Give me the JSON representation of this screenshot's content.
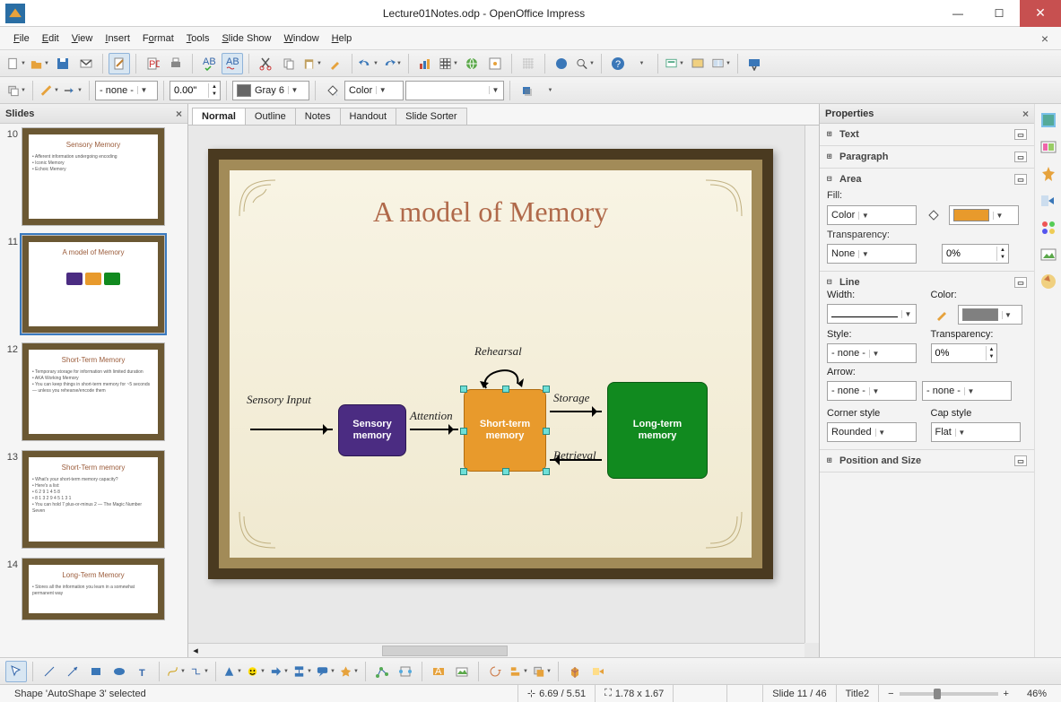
{
  "window": {
    "title": "Lecture01Notes.odp - OpenOffice Impress"
  },
  "menu": {
    "items": [
      "File",
      "Edit",
      "View",
      "Insert",
      "Format",
      "Tools",
      "Slide Show",
      "Window",
      "Help"
    ]
  },
  "toolbar2": {
    "line_style": "- none -",
    "line_width": "0.00\"",
    "area_mode": "Color",
    "area_color_label": "Gray 6"
  },
  "slidespanel": {
    "title": "Slides",
    "items": [
      {
        "num": "10",
        "title": "Sensory Memory",
        "body": "• Afferent information undergoing encoding\n• Iconic Memory\n• Echoic Memory"
      },
      {
        "num": "11",
        "title": "A model of Memory",
        "diagram": true
      },
      {
        "num": "12",
        "title": "Short-Term Memory",
        "body": "• Temporary storage for information with limited duration\n• AKA Working Memory\n• You can keep things in short-term memory for ~5 seconds — unless you rehearse/encode them"
      },
      {
        "num": "13",
        "title": "Short-Term memory",
        "body": "• What's your short-term memory capacity?\n• Here's a list:\n  • 6 2 9 1 4 5 8\n  • 8 1 3 2 9 4 5 1 3 1\n• You can hold 7 plus-or-minus 2 — The Magic Number Seven"
      },
      {
        "num": "14",
        "title": "Long-Term Memory",
        "body": "• Stores all the information you learn in a somewhat permanent way"
      }
    ],
    "selected": 1
  },
  "viewtabs": [
    "Normal",
    "Outline",
    "Notes",
    "Handout",
    "Slide Sorter"
  ],
  "slide": {
    "title": "A model of Memory",
    "labels": {
      "sensory_input": "Sensory Input",
      "attention": "Attention",
      "rehearsal": "Rehearsal",
      "storage": "Storage",
      "retrieval": "Retrieval"
    },
    "boxes": {
      "sensory": "Sensory\nmemory",
      "short": "Short-term\nmemory",
      "long": "Long-term\nmemory"
    }
  },
  "properties": {
    "title": "Properties",
    "sections": {
      "text": "Text",
      "paragraph": "Paragraph",
      "area": "Area",
      "line": "Line",
      "posSize": "Position and Size"
    },
    "area": {
      "fill_label": "Fill:",
      "fill_mode": "Color",
      "fill_color": "#e89a2c",
      "transparency_label": "Transparency:",
      "transparency_mode": "None",
      "transparency_value": "0%"
    },
    "line": {
      "width_label": "Width:",
      "color_label": "Color:",
      "line_color": "#808080",
      "style_label": "Style:",
      "style_value": "- none -",
      "transp_label": "Transparency:",
      "transp_value": "0%",
      "arrow_label": "Arrow:",
      "arrow_start": "- none -",
      "arrow_end": "- none -",
      "corner_label": "Corner style",
      "corner_value": "Rounded",
      "cap_label": "Cap style",
      "cap_value": "Flat"
    }
  },
  "status": {
    "selection": "Shape 'AutoShape 3' selected",
    "pos": "6.69 / 5.51",
    "size": "1.78 x 1.67",
    "slide": "Slide 11 / 46",
    "master": "Title2",
    "zoom": "46%"
  }
}
